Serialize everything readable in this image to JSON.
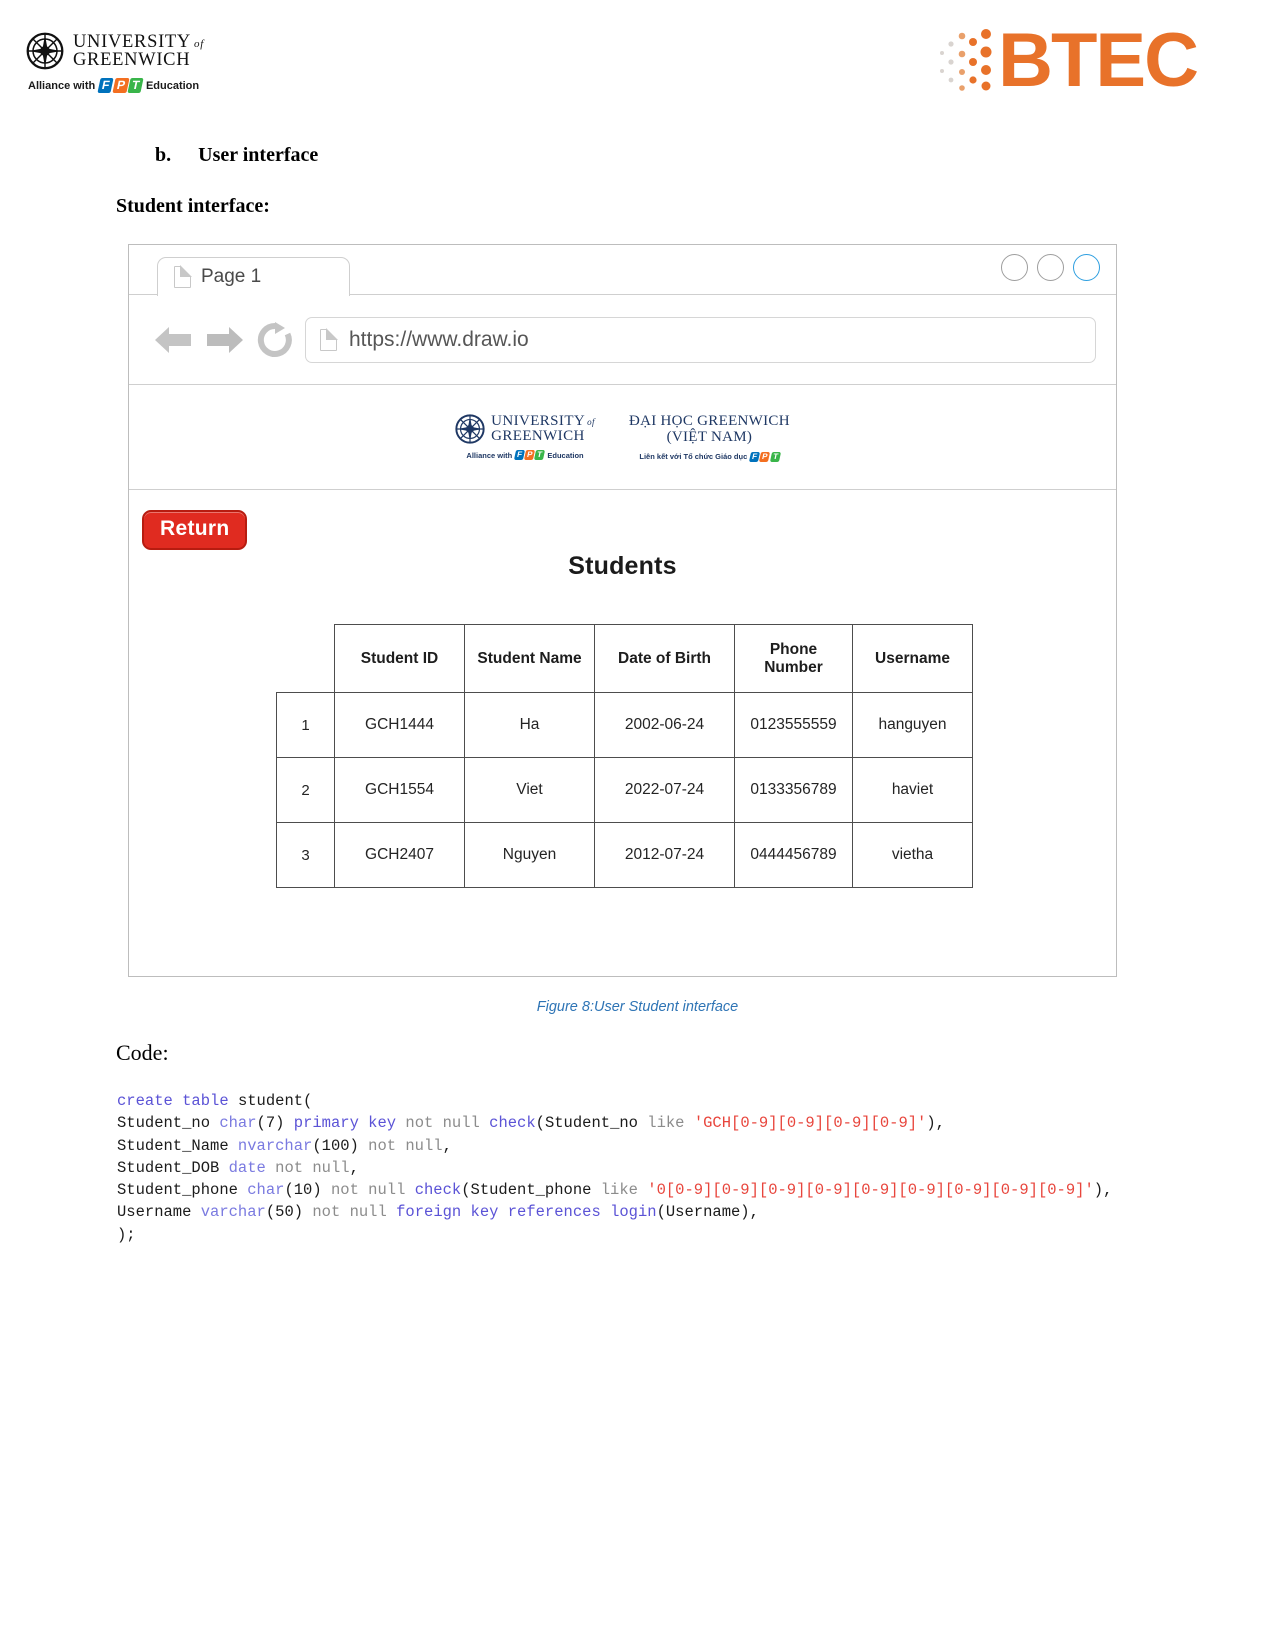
{
  "page_header": {
    "university": {
      "line1": "UNIVERSITY",
      "of": "of",
      "line2": "GREENWICH",
      "alliance_prefix": "Alliance with",
      "fpt": [
        "F",
        "P",
        "T"
      ],
      "alliance_suffix": "Education"
    },
    "btec": {
      "wordmark": "BTEC",
      "color": "#E8722A"
    }
  },
  "headings": {
    "section_marker": "b.",
    "section_title": "User interface",
    "subheading": "Student interface:"
  },
  "browser": {
    "tab": {
      "label": "Page 1",
      "icon": "document-icon"
    },
    "window_buttons": [
      "minimize-circle",
      "maximize-circle",
      "close-circle"
    ],
    "accent_circle_color": "#2e9fe0",
    "nav": {
      "back_icon": "arrow-left-icon",
      "forward_icon": "arrow-right-icon",
      "reload_icon": "reload-icon"
    },
    "address": {
      "icon": "page-icon",
      "value": "https://www.draw.io"
    }
  },
  "site": {
    "logos": {
      "uog": {
        "line1": "UNIVERSITY",
        "of": "of",
        "line2": "GREENWICH",
        "sub_prefix": "Alliance with",
        "fpt": [
          "F",
          "P",
          "T"
        ],
        "sub_suffix": "Education"
      },
      "vn": {
        "line1": "ĐẠI HỌC GREENWICH",
        "line2": "(VIỆT NAM)",
        "sub_prefix": "Liên kết với Tổ chức Giáo dục",
        "fpt": [
          "F",
          "P",
          "T"
        ]
      }
    },
    "return_button": "Return",
    "page_title": "Students",
    "table": {
      "index_header": "",
      "columns": [
        "Student ID",
        "Student Name",
        "Date of Birth",
        "Phone Number",
        "Username"
      ],
      "rows": [
        {
          "index": "1",
          "student_id": "GCH1444",
          "student_name": "Ha",
          "dob": "2002-06-24",
          "phone": "0123555559",
          "username": "hanguyen"
        },
        {
          "index": "2",
          "student_id": "GCH1554",
          "student_name": "Viet",
          "dob": "2022-07-24",
          "phone": "0133356789",
          "username": "haviet"
        },
        {
          "index": "3",
          "student_id": "GCH2407",
          "student_name": "Nguyen",
          "dob": "2012-07-24",
          "phone": "0444456789",
          "username": "vietha"
        }
      ]
    }
  },
  "figure_caption": "Figure 8:User  Student interface",
  "code_section": {
    "heading": "Code:",
    "lines": [
      [
        {
          "t": "create",
          "c": "kw"
        },
        {
          "t": " ",
          "c": "plain"
        },
        {
          "t": "table",
          "c": "kw"
        },
        {
          "t": " student(",
          "c": "plain"
        }
      ],
      [
        {
          "t": "Student_no ",
          "c": "plain"
        },
        {
          "t": "char",
          "c": "kw2"
        },
        {
          "t": "(7) ",
          "c": "plain"
        },
        {
          "t": "primary key",
          "c": "kw"
        },
        {
          "t": " ",
          "c": "plain"
        },
        {
          "t": "not null",
          "c": "gray"
        },
        {
          "t": " ",
          "c": "plain"
        },
        {
          "t": "check",
          "c": "kw"
        },
        {
          "t": "(Student_no ",
          "c": "plain"
        },
        {
          "t": "like",
          "c": "gray"
        },
        {
          "t": " ",
          "c": "plain"
        },
        {
          "t": "'GCH[0-9][0-9][0-9][0-9]'",
          "c": "str"
        },
        {
          "t": "),",
          "c": "plain"
        }
      ],
      [
        {
          "t": "Student_Name ",
          "c": "plain"
        },
        {
          "t": "nvarchar",
          "c": "kw2"
        },
        {
          "t": "(100) ",
          "c": "plain"
        },
        {
          "t": "not null",
          "c": "gray"
        },
        {
          "t": ",",
          "c": "plain"
        }
      ],
      [
        {
          "t": "Student_DOB ",
          "c": "plain"
        },
        {
          "t": "date",
          "c": "kw2"
        },
        {
          "t": " ",
          "c": "plain"
        },
        {
          "t": "not null",
          "c": "gray"
        },
        {
          "t": ",",
          "c": "plain"
        }
      ],
      [
        {
          "t": "Student_phone ",
          "c": "plain"
        },
        {
          "t": "char",
          "c": "kw2"
        },
        {
          "t": "(10) ",
          "c": "plain"
        },
        {
          "t": "not null",
          "c": "gray"
        },
        {
          "t": " ",
          "c": "plain"
        },
        {
          "t": "check",
          "c": "kw"
        },
        {
          "t": "(Student_phone ",
          "c": "plain"
        },
        {
          "t": "like",
          "c": "gray"
        },
        {
          "t": " ",
          "c": "plain"
        },
        {
          "t": "'0[0-9][0-9][0-9][0-9][0-9][0-9][0-9][0-9][0-9]'",
          "c": "str"
        },
        {
          "t": "),",
          "c": "plain"
        }
      ],
      [
        {
          "t": "Username ",
          "c": "plain"
        },
        {
          "t": "varchar",
          "c": "kw2"
        },
        {
          "t": "(50) ",
          "c": "plain"
        },
        {
          "t": "not",
          "c": "gray"
        },
        {
          "t": " ",
          "c": "plain"
        },
        {
          "t": "null",
          "c": "gray"
        },
        {
          "t": " ",
          "c": "plain"
        },
        {
          "t": "foreign key references",
          "c": "kw"
        },
        {
          "t": " ",
          "c": "plain"
        },
        {
          "t": "login",
          "c": "kw"
        },
        {
          "t": "(Username),",
          "c": "plain"
        }
      ],
      [
        {
          "t": ");",
          "c": "plain"
        }
      ]
    ]
  }
}
